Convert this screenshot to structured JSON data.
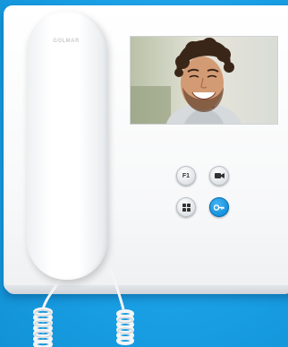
{
  "device": {
    "brand_label": "GOLMAR",
    "accent_color": "#1aa0e6",
    "buttons": [
      {
        "label": "F1",
        "icon": "f1-function-icon"
      },
      {
        "label": "",
        "icon": "video-camera-icon"
      },
      {
        "label": "",
        "icon": "menu-grid-icon"
      },
      {
        "label": "",
        "icon": "key-door-open-icon"
      }
    ],
    "screen_content": "smiling-man-portrait"
  }
}
